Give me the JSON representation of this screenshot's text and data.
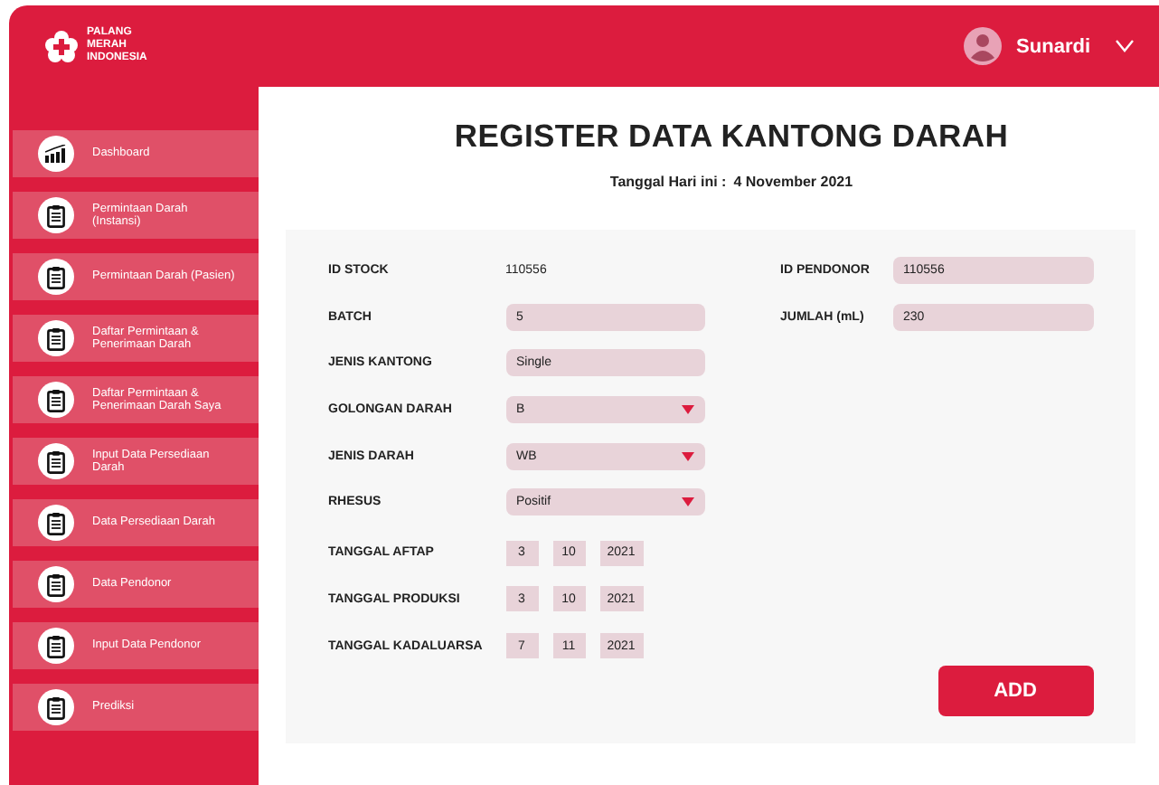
{
  "brand": {
    "lines": [
      "PALANG",
      "MERAH",
      "INDONESIA"
    ]
  },
  "user": {
    "name": "Sunardi"
  },
  "sidebar": {
    "items": [
      {
        "label": "Dashboard",
        "kind": "dashboard",
        "selected": false
      },
      {
        "label": "Permintaan Darah (Instansi)",
        "kind": "page",
        "selected": false
      },
      {
        "label": "Permintaan Darah (Pasien)",
        "kind": "page",
        "selected": false
      },
      {
        "label": "Daftar Permintaan & Penerimaan Darah",
        "kind": "page",
        "selected": false
      },
      {
        "label": "Daftar Permintaan & Penerimaan Darah Saya",
        "kind": "page",
        "selected": false
      },
      {
        "label": "Input Data Persediaan Darah",
        "kind": "page",
        "selected": false
      },
      {
        "label": "Data Persediaan Darah",
        "kind": "page",
        "selected": false
      },
      {
        "label": "Data Pendonor",
        "kind": "page",
        "selected": false
      },
      {
        "label": "Input Data Pendonor",
        "kind": "page",
        "selected": false
      },
      {
        "label": "Prediksi",
        "kind": "page",
        "selected": false
      }
    ]
  },
  "page": {
    "title": "REGISTER DATA KANTONG DARAH",
    "date_label": "Tanggal Hari ini :",
    "date": "4 November 2021"
  },
  "form": {
    "left": [
      {
        "label": "ID STOCK",
        "kind": "static",
        "value": "110556"
      },
      {
        "label": "BATCH",
        "kind": "text",
        "value": "5"
      },
      {
        "label": "JENIS KANTONG",
        "kind": "text",
        "value": "Single"
      },
      {
        "label": "GOLONGAN DARAH",
        "kind": "dropdown",
        "value": "B"
      },
      {
        "label": "JENIS DARAH",
        "kind": "dropdown",
        "value": "WB"
      },
      {
        "label": "RHESUS",
        "kind": "dropdown",
        "value": "Positif"
      },
      {
        "label": "TANGGAL AFTAP",
        "kind": "date",
        "parts": [
          "3",
          "10",
          "2021"
        ]
      },
      {
        "label": "TANGGAL PRODUKSI",
        "kind": "date",
        "parts": [
          "3",
          "10",
          "2021"
        ]
      },
      {
        "label": "TANGGAL KADALUARSA",
        "kind": "date",
        "parts": [
          "7",
          "11",
          "2021"
        ]
      }
    ],
    "right": [
      {
        "label": "ID PENDONOR",
        "kind": "text",
        "value": "110556"
      },
      {
        "label": "JUMLAH (mL)",
        "kind": "text",
        "value": "230"
      }
    ],
    "submit": "ADD"
  }
}
